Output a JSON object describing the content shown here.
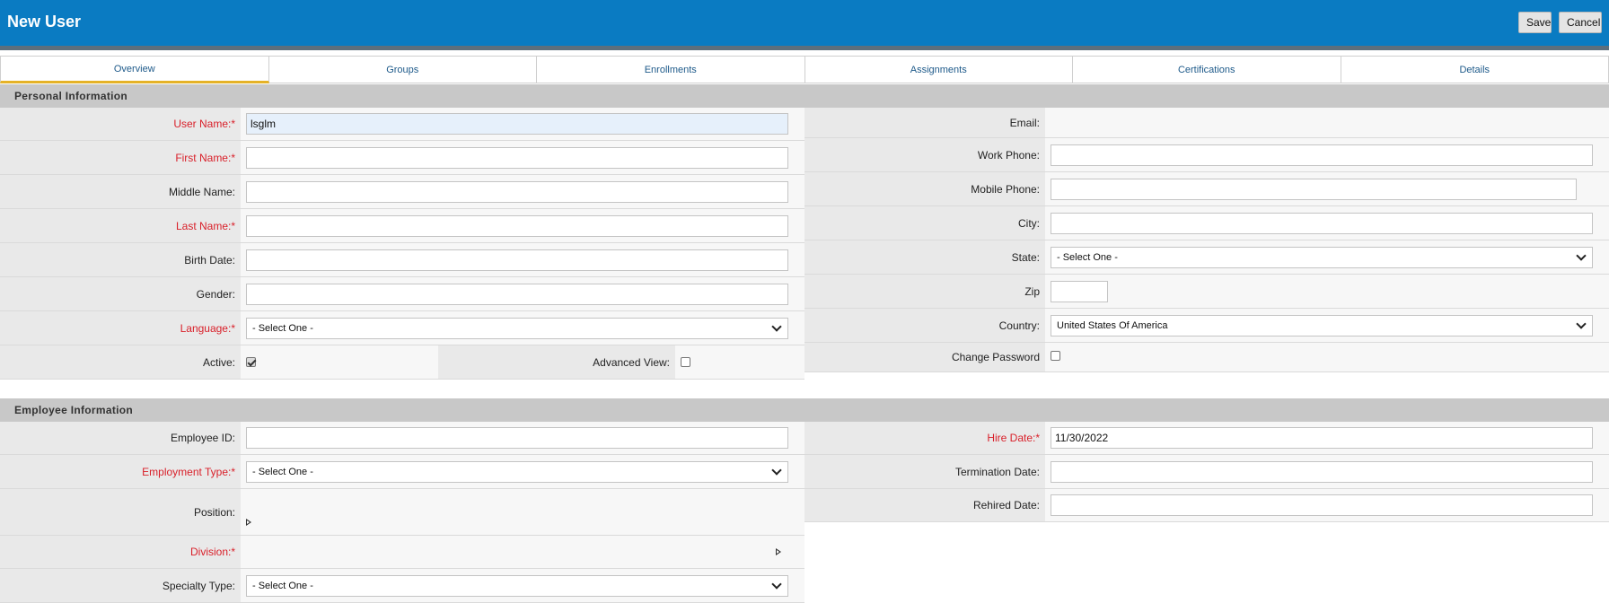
{
  "header": {
    "title": "New User",
    "save_label": "Save",
    "cancel_label": "Cancel"
  },
  "tabs": [
    "Overview",
    "Groups",
    "Enrollments",
    "Assignments",
    "Certifications",
    "Details"
  ],
  "personal": {
    "title": "Personal Information",
    "user_name": {
      "label": "User Name:*",
      "value": "lsglm"
    },
    "first_name": {
      "label": "First Name:*",
      "value": ""
    },
    "middle_name": {
      "label": "Middle Name:",
      "value": ""
    },
    "last_name": {
      "label": "Last Name:*",
      "value": ""
    },
    "birth_date": {
      "label": "Birth Date:",
      "value": ""
    },
    "gender": {
      "label": "Gender:",
      "value": ""
    },
    "language": {
      "label": "Language:*",
      "value": "- Select One -"
    },
    "active": {
      "label": "Active:",
      "checked": true
    },
    "advanced_view": {
      "label": "Advanced View:",
      "checked": false
    },
    "email": {
      "label": "Email:",
      "value": ""
    },
    "work_phone": {
      "label": "Work Phone:",
      "value": ""
    },
    "mobile_phone": {
      "label": "Mobile Phone:",
      "value": ""
    },
    "city": {
      "label": "City:",
      "value": ""
    },
    "state": {
      "label": "State:",
      "value": "- Select One -"
    },
    "zip": {
      "label": "Zip",
      "value": ""
    },
    "country": {
      "label": "Country:",
      "value": "United States Of America"
    },
    "change_password": {
      "label": "Change Password",
      "checked": false
    }
  },
  "employee": {
    "title": "Employee Information",
    "employee_id": {
      "label": "Employee ID:",
      "value": ""
    },
    "employment_type": {
      "label": "Employment Type:*",
      "value": "- Select One -"
    },
    "position": {
      "label": "Position:"
    },
    "division": {
      "label": "Division:*"
    },
    "specialty_type": {
      "label": "Specialty Type:",
      "value": "- Select One -"
    },
    "hire_date": {
      "label": "Hire Date:*",
      "value": "11/30/2022"
    },
    "termination_date": {
      "label": "Termination Date:",
      "value": ""
    },
    "rehired_date": {
      "label": "Rehired Date:",
      "value": ""
    }
  },
  "icons": [
    "chevron-down-icon",
    "expand-triangle-icon",
    "checkbox-icon"
  ],
  "colors": {
    "header_bg": "#0a7bc2",
    "required": "#d9202a",
    "tab_active": "#e5b227",
    "section_bg": "#c8c8c8"
  }
}
